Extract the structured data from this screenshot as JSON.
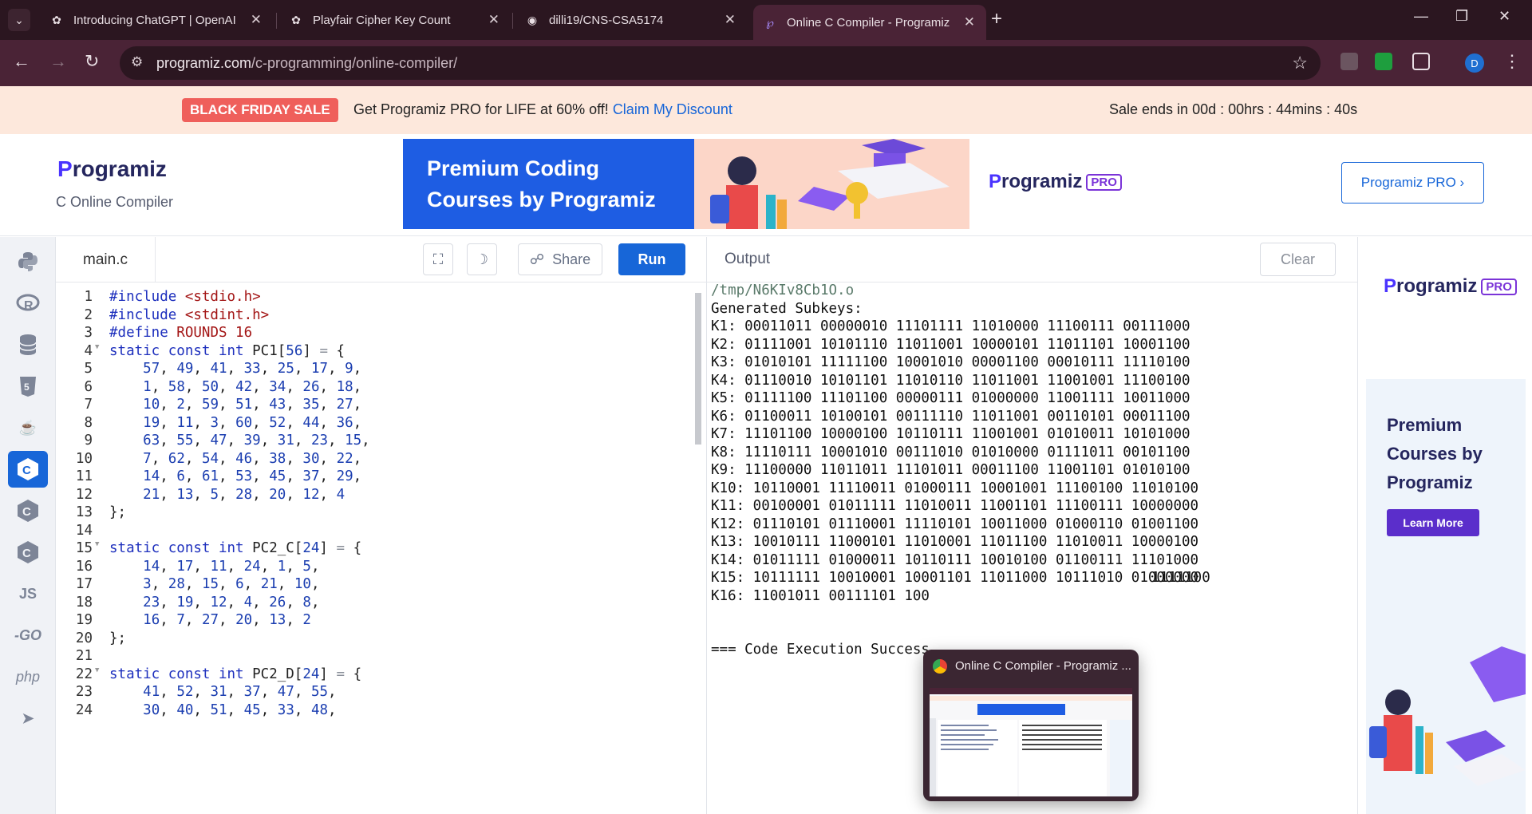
{
  "browser": {
    "tabs": [
      {
        "title": "Introducing ChatGPT | OpenAI",
        "icon": "openai-icon"
      },
      {
        "title": "Playfair Cipher Key Count",
        "icon": "openai-icon"
      },
      {
        "title": "dilli19/CNS-CSA5174",
        "icon": "github-icon"
      },
      {
        "title": "Online C Compiler - Programiz",
        "icon": "programiz-icon",
        "active": true
      }
    ],
    "url_host": "programiz.com",
    "url_path": "/c-programming/online-compiler/",
    "profile_initial": "D"
  },
  "sale": {
    "badge": "BLACK FRIDAY SALE",
    "text": "Get Programiz PRO for LIFE at 60% off!",
    "link": "Claim My Discount",
    "timer": "Sale ends in 00d : 00hrs : 44mins : 40s"
  },
  "header": {
    "logo": "rogramiz",
    "subtitle": "C Online Compiler",
    "ad_text": "Premium Coding Courses by Programiz",
    "ad_logo": "rogramiz",
    "ad_pro": "PRO",
    "pro_button": "Programiz PRO ›"
  },
  "rail": {
    "items": [
      "python-icon",
      "r-icon",
      "sql-icon",
      "html5-icon",
      "java-icon",
      "c-icon",
      "cpp-icon",
      "csharp-icon",
      "js-icon",
      "go-icon",
      "php-icon",
      "swift-icon"
    ],
    "labels": {
      "js": "JS",
      "go": "-GO",
      "php": "php"
    }
  },
  "editor": {
    "filename": "main.c",
    "share_label": "Share",
    "run_label": "Run",
    "lines": [
      {
        "n": "1",
        "tokens": [
          [
            "pre",
            "#include "
          ],
          [
            "str",
            "<stdio.h>"
          ]
        ]
      },
      {
        "n": "2",
        "tokens": [
          [
            "pre",
            "#include "
          ],
          [
            "str",
            "<stdint.h>"
          ]
        ]
      },
      {
        "n": "3",
        "tokens": [
          [
            "pre",
            "#define "
          ],
          [
            "str",
            "ROUNDS 16"
          ]
        ]
      },
      {
        "n": "4",
        "fold": true,
        "tokens": [
          [
            "kw",
            "static const int "
          ],
          [
            "",
            "PC1["
          ],
          [
            "num",
            "56"
          ],
          [
            "",
            "] "
          ],
          [
            "op",
            "="
          ],
          [
            "",
            " {"
          ]
        ]
      },
      {
        "n": "5",
        "tokens": [
          [
            "",
            "    "
          ],
          [
            "num",
            "57"
          ],
          [
            "",
            ", "
          ],
          [
            "num",
            "49"
          ],
          [
            "",
            ", "
          ],
          [
            "num",
            "41"
          ],
          [
            "",
            ", "
          ],
          [
            "num",
            "33"
          ],
          [
            "",
            ", "
          ],
          [
            "num",
            "25"
          ],
          [
            "",
            ", "
          ],
          [
            "num",
            "17"
          ],
          [
            "",
            ", "
          ],
          [
            "num",
            "9"
          ],
          [
            "",
            ","
          ]
        ]
      },
      {
        "n": "6",
        "tokens": [
          [
            "",
            "    "
          ],
          [
            "num",
            "1"
          ],
          [
            "",
            ", "
          ],
          [
            "num",
            "58"
          ],
          [
            "",
            ", "
          ],
          [
            "num",
            "50"
          ],
          [
            "",
            ", "
          ],
          [
            "num",
            "42"
          ],
          [
            "",
            ", "
          ],
          [
            "num",
            "34"
          ],
          [
            "",
            ", "
          ],
          [
            "num",
            "26"
          ],
          [
            "",
            ", "
          ],
          [
            "num",
            "18"
          ],
          [
            "",
            ","
          ]
        ]
      },
      {
        "n": "7",
        "tokens": [
          [
            "",
            "    "
          ],
          [
            "num",
            "10"
          ],
          [
            "",
            ", "
          ],
          [
            "num",
            "2"
          ],
          [
            "",
            ", "
          ],
          [
            "num",
            "59"
          ],
          [
            "",
            ", "
          ],
          [
            "num",
            "51"
          ],
          [
            "",
            ", "
          ],
          [
            "num",
            "43"
          ],
          [
            "",
            ", "
          ],
          [
            "num",
            "35"
          ],
          [
            "",
            ", "
          ],
          [
            "num",
            "27"
          ],
          [
            "",
            ","
          ]
        ]
      },
      {
        "n": "8",
        "tokens": [
          [
            "",
            "    "
          ],
          [
            "num",
            "19"
          ],
          [
            "",
            ", "
          ],
          [
            "num",
            "11"
          ],
          [
            "",
            ", "
          ],
          [
            "num",
            "3"
          ],
          [
            "",
            ", "
          ],
          [
            "num",
            "60"
          ],
          [
            "",
            ", "
          ],
          [
            "num",
            "52"
          ],
          [
            "",
            ", "
          ],
          [
            "num",
            "44"
          ],
          [
            "",
            ", "
          ],
          [
            "num",
            "36"
          ],
          [
            "",
            ","
          ]
        ]
      },
      {
        "n": "9",
        "tokens": [
          [
            "",
            "    "
          ],
          [
            "num",
            "63"
          ],
          [
            "",
            ", "
          ],
          [
            "num",
            "55"
          ],
          [
            "",
            ", "
          ],
          [
            "num",
            "47"
          ],
          [
            "",
            ", "
          ],
          [
            "num",
            "39"
          ],
          [
            "",
            ", "
          ],
          [
            "num",
            "31"
          ],
          [
            "",
            ", "
          ],
          [
            "num",
            "23"
          ],
          [
            "",
            ", "
          ],
          [
            "num",
            "15"
          ],
          [
            "",
            ","
          ]
        ]
      },
      {
        "n": "10",
        "tokens": [
          [
            "",
            "    "
          ],
          [
            "num",
            "7"
          ],
          [
            "",
            ", "
          ],
          [
            "num",
            "62"
          ],
          [
            "",
            ", "
          ],
          [
            "num",
            "54"
          ],
          [
            "",
            ", "
          ],
          [
            "num",
            "46"
          ],
          [
            "",
            ", "
          ],
          [
            "num",
            "38"
          ],
          [
            "",
            ", "
          ],
          [
            "num",
            "30"
          ],
          [
            "",
            ", "
          ],
          [
            "num",
            "22"
          ],
          [
            "",
            ","
          ]
        ]
      },
      {
        "n": "11",
        "tokens": [
          [
            "",
            "    "
          ],
          [
            "num",
            "14"
          ],
          [
            "",
            ", "
          ],
          [
            "num",
            "6"
          ],
          [
            "",
            ", "
          ],
          [
            "num",
            "61"
          ],
          [
            "",
            ", "
          ],
          [
            "num",
            "53"
          ],
          [
            "",
            ", "
          ],
          [
            "num",
            "45"
          ],
          [
            "",
            ", "
          ],
          [
            "num",
            "37"
          ],
          [
            "",
            ", "
          ],
          [
            "num",
            "29"
          ],
          [
            "",
            ","
          ]
        ]
      },
      {
        "n": "12",
        "tokens": [
          [
            "",
            "    "
          ],
          [
            "num",
            "21"
          ],
          [
            "",
            ", "
          ],
          [
            "num",
            "13"
          ],
          [
            "",
            ", "
          ],
          [
            "num",
            "5"
          ],
          [
            "",
            ", "
          ],
          [
            "num",
            "28"
          ],
          [
            "",
            ", "
          ],
          [
            "num",
            "20"
          ],
          [
            "",
            ", "
          ],
          [
            "num",
            "12"
          ],
          [
            "",
            ", "
          ],
          [
            "num",
            "4"
          ]
        ]
      },
      {
        "n": "13",
        "tokens": [
          [
            "",
            "};"
          ]
        ]
      },
      {
        "n": "14",
        "tokens": []
      },
      {
        "n": "15",
        "fold": true,
        "tokens": [
          [
            "kw",
            "static const int "
          ],
          [
            "",
            "PC2_C["
          ],
          [
            "num",
            "24"
          ],
          [
            "",
            "] "
          ],
          [
            "op",
            "="
          ],
          [
            "",
            " {"
          ]
        ]
      },
      {
        "n": "16",
        "tokens": [
          [
            "",
            "    "
          ],
          [
            "num",
            "14"
          ],
          [
            "",
            ", "
          ],
          [
            "num",
            "17"
          ],
          [
            "",
            ", "
          ],
          [
            "num",
            "11"
          ],
          [
            "",
            ", "
          ],
          [
            "num",
            "24"
          ],
          [
            "",
            ", "
          ],
          [
            "num",
            "1"
          ],
          [
            "",
            ", "
          ],
          [
            "num",
            "5"
          ],
          [
            "",
            ","
          ]
        ]
      },
      {
        "n": "17",
        "tokens": [
          [
            "",
            "    "
          ],
          [
            "num",
            "3"
          ],
          [
            "",
            ", "
          ],
          [
            "num",
            "28"
          ],
          [
            "",
            ", "
          ],
          [
            "num",
            "15"
          ],
          [
            "",
            ", "
          ],
          [
            "num",
            "6"
          ],
          [
            "",
            ", "
          ],
          [
            "num",
            "21"
          ],
          [
            "",
            ", "
          ],
          [
            "num",
            "10"
          ],
          [
            "",
            ","
          ]
        ]
      },
      {
        "n": "18",
        "tokens": [
          [
            "",
            "    "
          ],
          [
            "num",
            "23"
          ],
          [
            "",
            ", "
          ],
          [
            "num",
            "19"
          ],
          [
            "",
            ", "
          ],
          [
            "num",
            "12"
          ],
          [
            "",
            ", "
          ],
          [
            "num",
            "4"
          ],
          [
            "",
            ", "
          ],
          [
            "num",
            "26"
          ],
          [
            "",
            ", "
          ],
          [
            "num",
            "8"
          ],
          [
            "",
            ","
          ]
        ]
      },
      {
        "n": "19",
        "tokens": [
          [
            "",
            "    "
          ],
          [
            "num",
            "16"
          ],
          [
            "",
            ", "
          ],
          [
            "num",
            "7"
          ],
          [
            "",
            ", "
          ],
          [
            "num",
            "27"
          ],
          [
            "",
            ", "
          ],
          [
            "num",
            "20"
          ],
          [
            "",
            ", "
          ],
          [
            "num",
            "13"
          ],
          [
            "",
            ", "
          ],
          [
            "num",
            "2"
          ]
        ]
      },
      {
        "n": "20",
        "tokens": [
          [
            "",
            "};"
          ]
        ]
      },
      {
        "n": "21",
        "tokens": []
      },
      {
        "n": "22",
        "fold": true,
        "tokens": [
          [
            "kw",
            "static const int "
          ],
          [
            "",
            "PC2_D["
          ],
          [
            "num",
            "24"
          ],
          [
            "",
            "] "
          ],
          [
            "op",
            "="
          ],
          [
            "",
            " {"
          ]
        ]
      },
      {
        "n": "23",
        "tokens": [
          [
            "",
            "    "
          ],
          [
            "num",
            "41"
          ],
          [
            "",
            ", "
          ],
          [
            "num",
            "52"
          ],
          [
            "",
            ", "
          ],
          [
            "num",
            "31"
          ],
          [
            "",
            ", "
          ],
          [
            "num",
            "37"
          ],
          [
            "",
            ", "
          ],
          [
            "num",
            "47"
          ],
          [
            "",
            ", "
          ],
          [
            "num",
            "55"
          ],
          [
            "",
            ","
          ]
        ]
      },
      {
        "n": "24",
        "tokens": [
          [
            "",
            "    "
          ],
          [
            "num",
            "30"
          ],
          [
            "",
            ", "
          ],
          [
            "num",
            "40"
          ],
          [
            "",
            ", "
          ],
          [
            "num",
            "51"
          ],
          [
            "",
            ", "
          ],
          [
            "num",
            "45"
          ],
          [
            "",
            ", "
          ],
          [
            "num",
            "33"
          ],
          [
            "",
            ", "
          ],
          [
            "num",
            "48"
          ],
          [
            "",
            ","
          ]
        ]
      }
    ]
  },
  "output": {
    "title": "Output",
    "clear_label": "Clear",
    "path": "/tmp/N6KIv8Cb1O.o",
    "lines": [
      "Generated Subkeys:",
      "K1: 00011011 00000010 11101111 11010000 11100111 00111000",
      "K2: 01111001 10101110 11011001 10000101 11011101 10001100",
      "K3: 01010101 11111100 10001010 00001100 00010111 11110100",
      "K4: 01110010 10101101 11010110 11011001 11001001 11100100",
      "K5: 01111100 11101100 00000111 01000000 11001111 10011000",
      "K6: 01100011 10100101 00111110 11011001 00110101 00011100",
      "K7: 11101100 10000100 10110111 11001001 01010011 10101000",
      "K8: 11110111 10001010 00111010 01010000 01111011 00101100",
      "K9: 11100000 11011011 11101011 00011100 11001101 01010100",
      "K10: 10110001 11110011 01000111 10001001 11100100 11010100",
      "K11: 00100001 01011111 11010011 11001101 11100111 10000000",
      "K12: 01110101 01110001 11110101 10011000 01000110 01001100",
      "K13: 10010111 11000101 11010001 11011100 11010011 10000100",
      "K14: 01011111 01000011 10110111 10010100 01100111 11101000",
      "K15: 10111111 10010001 10001101 11011000 10111010 01000000",
      "K16: 11001011 00111101 100",
      "",
      "",
      "=== Code Execution Success"
    ],
    "k16_tail": "1111100"
  },
  "right_ad": {
    "logo": "rogramiz",
    "pro": "PRO",
    "headline": "Premium Courses by Programiz",
    "button": "Learn More"
  },
  "preview": {
    "title": "Online C Compiler - Programiz ..."
  },
  "colors": {
    "accent": "#1766d8",
    "chrome_dark": "#2b1620",
    "chrome_mid": "#4a2336",
    "sale_bg": "#fde8dc"
  }
}
